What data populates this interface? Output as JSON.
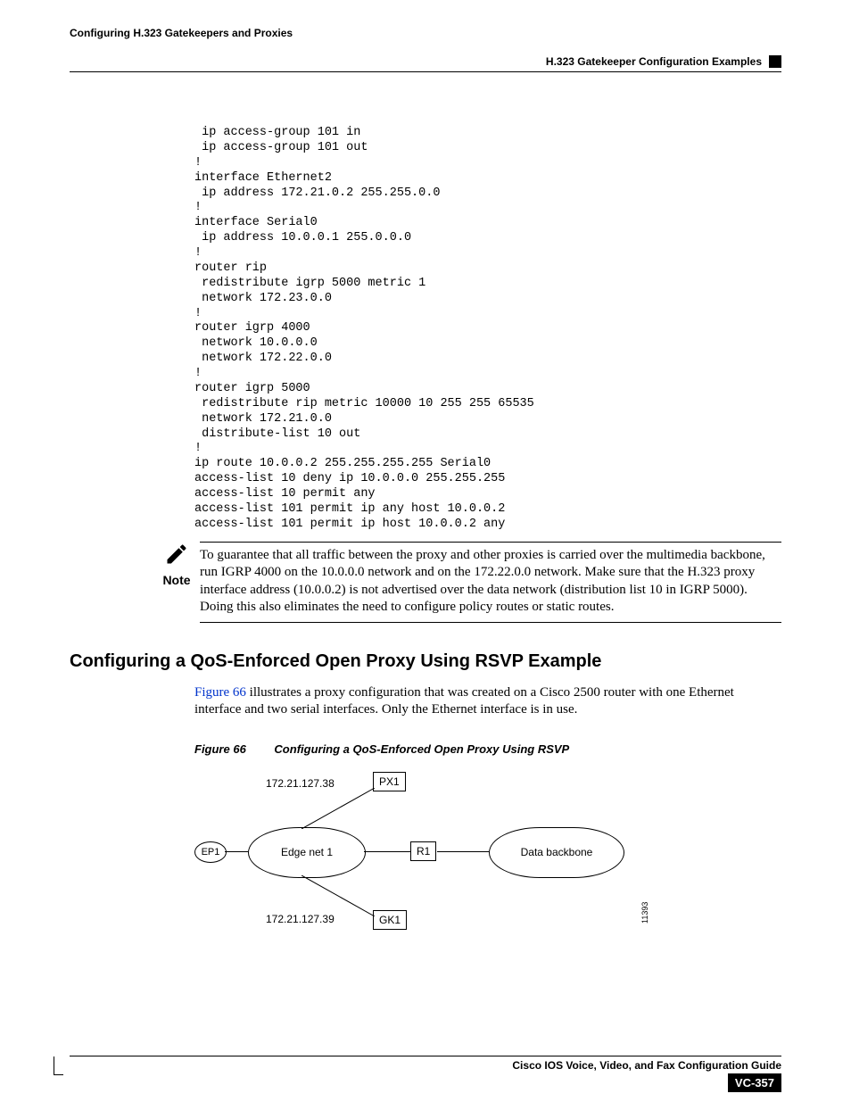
{
  "header": {
    "left": "Configuring H.323 Gatekeepers and Proxies",
    "right": "H.323 Gatekeeper Configuration Examples"
  },
  "code": " ip access-group 101 in\n ip access-group 101 out\n!\ninterface Ethernet2\n ip address 172.21.0.2 255.255.0.0\n!\ninterface Serial0\n ip address 10.0.0.1 255.0.0.0\n!\nrouter rip\n redistribute igrp 5000 metric 1\n network 172.23.0.0\n!\nrouter igrp 4000\n network 10.0.0.0\n network 172.22.0.0\n!\nrouter igrp 5000\n redistribute rip metric 10000 10 255 255 65535\n network 172.21.0.0\n distribute-list 10 out\n!\nip route 10.0.0.2 255.255.255.255 Serial0\naccess-list 10 deny ip 10.0.0.0 255.255.255\naccess-list 10 permit any\naccess-list 101 permit ip any host 10.0.0.2\naccess-list 101 permit ip host 10.0.0.2 any",
  "note": {
    "label": "Note",
    "text": "To guarantee that all traffic between the proxy and other proxies is carried over the multimedia backbone, run IGRP 4000 on the 10.0.0.0 network and on the 172.22.0.0 network. Make sure that the H.323 proxy interface address (10.0.0.2) is not advertised over the data network (distribution list 10 in IGRP 5000). Doing this also eliminates the need to configure policy routes or static routes."
  },
  "section_heading": "Configuring a QoS-Enforced Open Proxy Using RSVP Example",
  "paragraph": {
    "link": "Figure 66",
    "rest": " illustrates a proxy configuration that was created on a Cisco 2500 router with one Ethernet interface and two serial interfaces. Only the Ethernet interface is in use."
  },
  "figure": {
    "caption_num": "Figure 66",
    "caption_title": "Configuring a QoS-Enforced Open Proxy Using RSVP",
    "ep1": "EP1",
    "edge_net": "Edge net 1",
    "r1": "R1",
    "backbone": "Data backbone",
    "px1": "PX1",
    "gk1": "GK1",
    "ip_top": "172.21.127.38",
    "ip_bottom": "172.21.127.39",
    "side_num": "11393"
  },
  "footer": {
    "title": "Cisco IOS Voice, Video, and Fax Configuration Guide",
    "page": "VC-357"
  }
}
